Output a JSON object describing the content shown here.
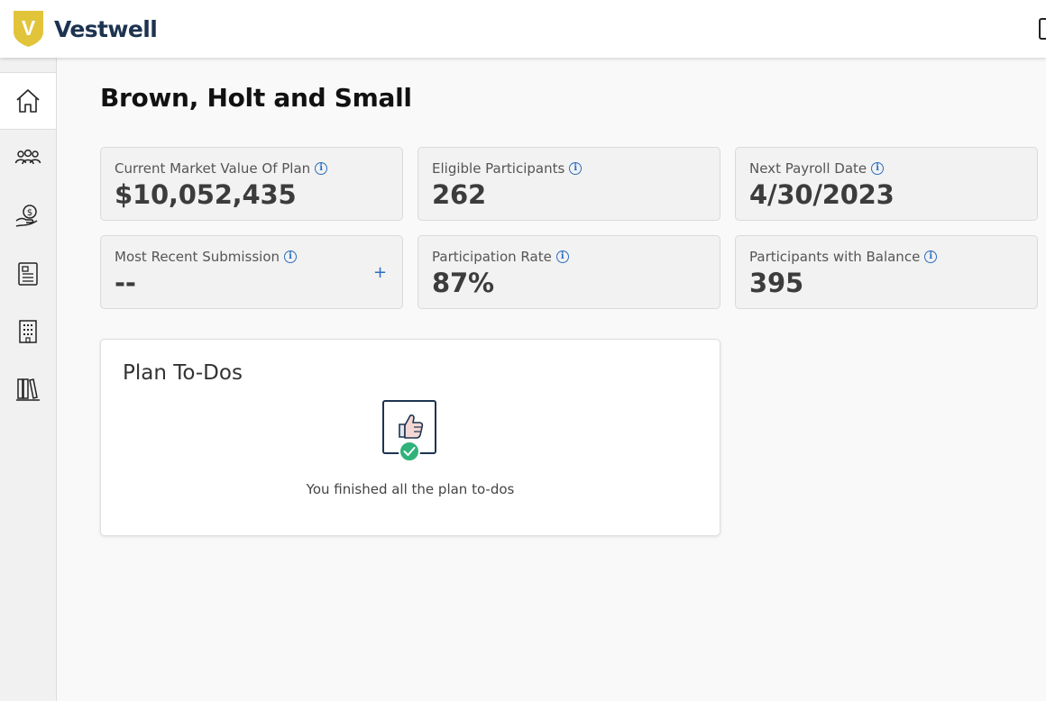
{
  "app": {
    "brand": "Vestwell",
    "logo_letter": "V"
  },
  "sidebar": {
    "items": [
      {
        "icon": "home-icon",
        "active": true
      },
      {
        "icon": "people-icon",
        "active": false
      },
      {
        "icon": "hand-coin-icon",
        "active": false
      },
      {
        "icon": "document-icon",
        "active": false
      },
      {
        "icon": "building-icon",
        "active": false
      },
      {
        "icon": "library-icon",
        "active": false
      }
    ]
  },
  "page": {
    "title": "Brown, Holt and Small"
  },
  "stats": [
    {
      "label": "Current Market Value Of Plan",
      "value": "$10,052,435"
    },
    {
      "label": "Eligible Participants",
      "value": "262"
    },
    {
      "label": "Next Payroll Date",
      "value": "4/30/2023"
    },
    {
      "label": "Most Recent Submission",
      "value": "--",
      "action": "+"
    },
    {
      "label": "Participation Rate",
      "value": "87%"
    },
    {
      "label": "Participants with Balance",
      "value": "395"
    }
  ],
  "todos": {
    "title": "Plan To-Dos",
    "message": "You finished all the plan to-dos",
    "icon": "thumbs-up-check-icon"
  },
  "colors": {
    "accent": "#2a6ec0",
    "brand_navy": "#1d3350",
    "brand_gold": "#e2c43b",
    "success": "#2fb37a"
  }
}
